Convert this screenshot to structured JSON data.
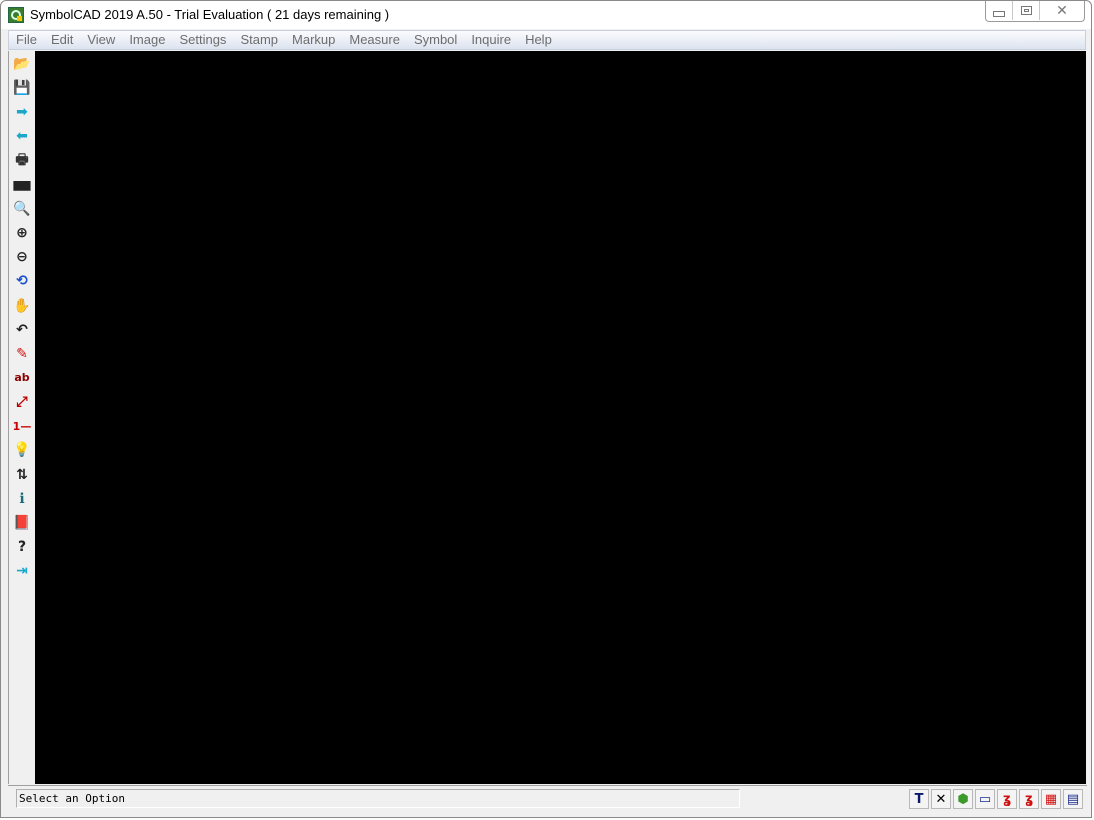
{
  "window": {
    "title": "SymbolCAD 2019 A.50 - Trial Evaluation ( 21 days remaining )",
    "controls": {
      "minimize": "minimize",
      "maximize": "maximize",
      "close": "close"
    }
  },
  "menu": [
    "File",
    "Edit",
    "View",
    "Image",
    "Settings",
    "Stamp",
    "Markup",
    "Measure",
    "Symbol",
    "Inquire",
    "Help"
  ],
  "toolbar": [
    {
      "name": "open-folder-icon",
      "glyph": "📂",
      "color": "#b8860b"
    },
    {
      "name": "save-icon",
      "glyph": "💾",
      "color": "#333"
    },
    {
      "name": "forward-arrow-icon",
      "glyph": "➡",
      "color": "#1aa7c9"
    },
    {
      "name": "back-arrow-icon",
      "glyph": "⬅",
      "color": "#1aa7c9"
    },
    {
      "name": "print-icon",
      "glyph": "🖶",
      "color": "#333"
    },
    {
      "name": "binoculars-icon",
      "glyph": "▆▆",
      "color": "#222"
    },
    {
      "name": "magnifier-icon",
      "glyph": "🔍",
      "color": "#222"
    },
    {
      "name": "zoom-in-icon",
      "glyph": "⊕",
      "color": "#222"
    },
    {
      "name": "zoom-out-icon",
      "glyph": "⊖",
      "color": "#222"
    },
    {
      "name": "zoom-previous-icon",
      "glyph": "⟲",
      "color": "#1a4fc9"
    },
    {
      "name": "pan-hand-icon",
      "glyph": "✋",
      "color": "#444"
    },
    {
      "name": "undo-arrow-icon",
      "glyph": "↶",
      "color": "#222"
    },
    {
      "name": "pencil-icon",
      "glyph": "✎",
      "color": "#d01010"
    },
    {
      "name": "text-ab-icon",
      "glyph": "ab",
      "color": "#8b0000"
    },
    {
      "name": "dimension-icon",
      "glyph": "⤢",
      "color": "#b00"
    },
    {
      "name": "numbered-list-icon",
      "glyph": "1—",
      "color": "#c00"
    },
    {
      "name": "lightbulb-icon",
      "glyph": "💡",
      "color": "#d4b000"
    },
    {
      "name": "adjust-icon",
      "glyph": "⇅",
      "color": "#222"
    },
    {
      "name": "info-icon",
      "glyph": "ℹ",
      "color": "#1a6b7a"
    },
    {
      "name": "book-icon",
      "glyph": "📕",
      "color": "#7a2a7a"
    },
    {
      "name": "help-icon",
      "glyph": "?",
      "color": "#222"
    },
    {
      "name": "exit-door-icon",
      "glyph": "⇥",
      "color": "#1aa7c9"
    }
  ],
  "status": {
    "message": "Select an Option",
    "icons": [
      {
        "name": "text-tool-icon",
        "glyph": "T",
        "color": "#0a1a6a"
      },
      {
        "name": "delete-icon",
        "glyph": "✕",
        "color": "#000"
      },
      {
        "name": "layer-icon",
        "glyph": "⬢",
        "color": "#3a9a2a"
      },
      {
        "name": "window-icon",
        "glyph": "▭",
        "color": "#1a2a8a"
      },
      {
        "name": "symbol-icon",
        "glyph": "ʓ",
        "color": "#d01010"
      },
      {
        "name": "symbol-lock-icon",
        "glyph": "ʓ",
        "color": "#d01010"
      },
      {
        "name": "color-palette-icon",
        "glyph": "▦",
        "color": "#d01010"
      },
      {
        "name": "display-icon",
        "glyph": "▤",
        "color": "#1a2a8a"
      }
    ]
  }
}
